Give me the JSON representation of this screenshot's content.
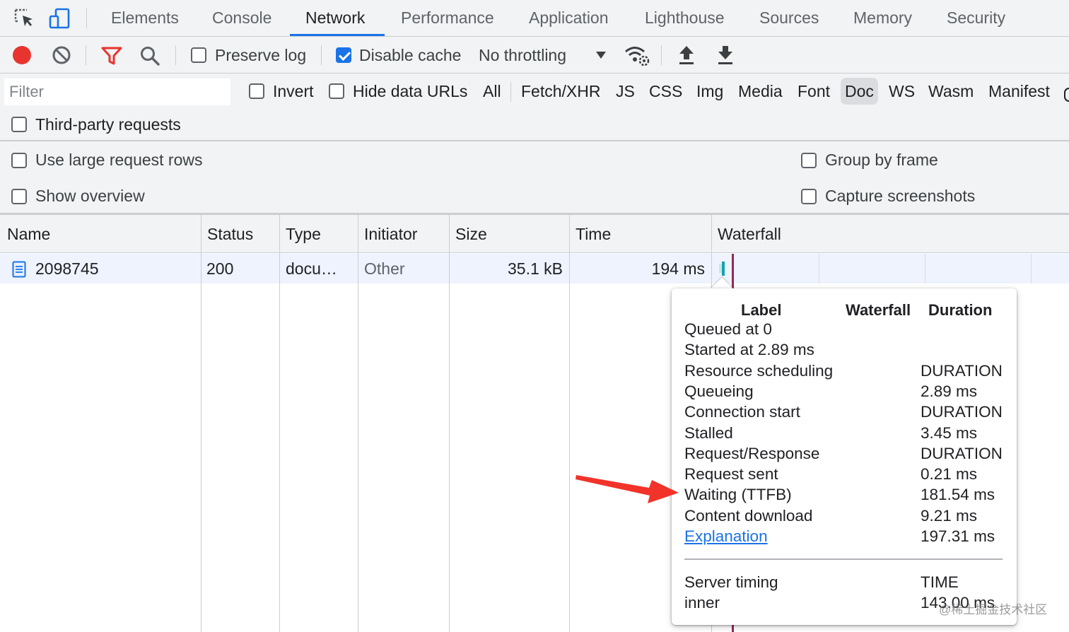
{
  "tabs": [
    "Elements",
    "Console",
    "Network",
    "Performance",
    "Application",
    "Lighthouse",
    "Sources",
    "Memory",
    "Security"
  ],
  "active_tab": "Network",
  "toolbar": {
    "preserve_log": "Preserve log",
    "preserve_log_checked": false,
    "disable_cache": "Disable cache",
    "disable_cache_checked": true,
    "throttling": "No throttling"
  },
  "filter": {
    "placeholder": "Filter",
    "invert": "Invert",
    "hide_data_urls": "Hide data URLs",
    "types": [
      "All",
      "Fetch/XHR",
      "JS",
      "CSS",
      "Img",
      "Media",
      "Font",
      "Doc",
      "WS",
      "Wasm",
      "Manifest"
    ],
    "selected_type": "Doc",
    "third_party": "Third-party requests"
  },
  "settings": {
    "large_rows": "Use large request rows",
    "group_by_frame": "Group by frame",
    "show_overview": "Show overview",
    "capture_screenshots": "Capture screenshots"
  },
  "table": {
    "headers": {
      "name": "Name",
      "status": "Status",
      "type": "Type",
      "initiator": "Initiator",
      "size": "Size",
      "time": "Time",
      "waterfall": "Waterfall"
    },
    "rows": [
      {
        "name": "2098745",
        "status": "200",
        "type": "docu…",
        "initiator": "Other",
        "size": "35.1 kB",
        "time": "194 ms"
      }
    ]
  },
  "tooltip": {
    "headers": {
      "label": "Label",
      "waterfall": "Waterfall",
      "duration": "Duration"
    },
    "rows": [
      {
        "label": "Queued at 0",
        "value": ""
      },
      {
        "label": "Started at 2.89 ms",
        "value": ""
      },
      {
        "label": "Resource scheduling",
        "value": "DURATION"
      },
      {
        "label": "Queueing",
        "value": "2.89 ms"
      },
      {
        "label": "Connection start",
        "value": "DURATION"
      },
      {
        "label": "Stalled",
        "value": "3.45 ms"
      },
      {
        "label": "Request/Response",
        "value": "DURATION"
      },
      {
        "label": "Request sent",
        "value": "0.21 ms"
      },
      {
        "label": "Waiting (TTFB)",
        "value": "181.54 ms"
      },
      {
        "label": "Content download",
        "value": "9.21 ms"
      }
    ],
    "explanation": "Explanation",
    "total": "197.31 ms",
    "server_timing": "Server timing",
    "server_timing_header": "TIME",
    "server_rows": [
      {
        "label": "inner",
        "value": "143.00 ms"
      }
    ]
  },
  "watermark": "@稀土掘金技术社区",
  "colors": {
    "accent": "#1a73e8",
    "record": "#e8342f",
    "annotation_arrow": "#f2332a"
  }
}
